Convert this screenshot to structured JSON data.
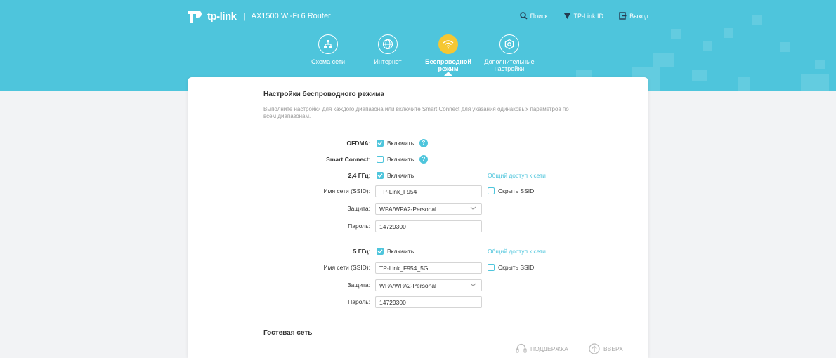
{
  "header": {
    "brand": "tp-link",
    "separator": "|",
    "model": "AX1500 Wi-Fi 6 Router",
    "links": [
      {
        "label": "Поиск",
        "icon": "search-icon"
      },
      {
        "label": "TP-Link ID",
        "icon": "tplink-id-icon"
      },
      {
        "label": "Выход",
        "icon": "logout-icon"
      }
    ],
    "nav": [
      {
        "label": "Схема сети",
        "icon": "network-map-icon",
        "active": false
      },
      {
        "label": "Интернет",
        "icon": "globe-icon",
        "active": false
      },
      {
        "label": "Беспроводной режим",
        "icon": "wifi-icon",
        "active": true
      },
      {
        "label": "Дополнительные настройки",
        "icon": "gear-icon",
        "active": false
      }
    ],
    "colors": {
      "accent": "#4ec5dc",
      "active_nav": "#f5c732"
    }
  },
  "main": {
    "title": "Настройки беспроводного режима",
    "description": "Выполните настройки для каждого диапазона или включите Smart Connect для указания одинаковых параметров по всем диапазонам.",
    "ofdma": {
      "label": "OFDMA",
      "option": "Включить",
      "checked": true
    },
    "smart_connect": {
      "label": "Smart Connect",
      "option": "Включить",
      "checked": false
    },
    "band24": {
      "label": "2,4 ГГц",
      "option": "Включить",
      "checked": true,
      "share_link": "Общий доступ к сети",
      "ssid_label": "Имя сети (SSID)",
      "ssid": "TP-Link_F954",
      "hide_ssid": "Скрыть SSID",
      "security_label": "Защита",
      "security": "WPA/WPA2-Personal",
      "password_label": "Пароль",
      "password": "14729300"
    },
    "band5": {
      "label": "5 ГГц",
      "option": "Включить",
      "checked": true,
      "share_link": "Общий доступ к сети",
      "ssid_label": "Имя сети (SSID)",
      "ssid": "TP-Link_F954_5G",
      "hide_ssid": "Скрыть SSID",
      "security_label": "Защита",
      "security": "WPA/WPA2-Personal",
      "password_label": "Пароль",
      "password": "14729300"
    },
    "guest_title": "Гостевая сеть",
    "colon": ":",
    "help_glyph": "?"
  },
  "footer": {
    "support": "ПОДДЕРЖКА",
    "up": "ВВЕРХ"
  }
}
